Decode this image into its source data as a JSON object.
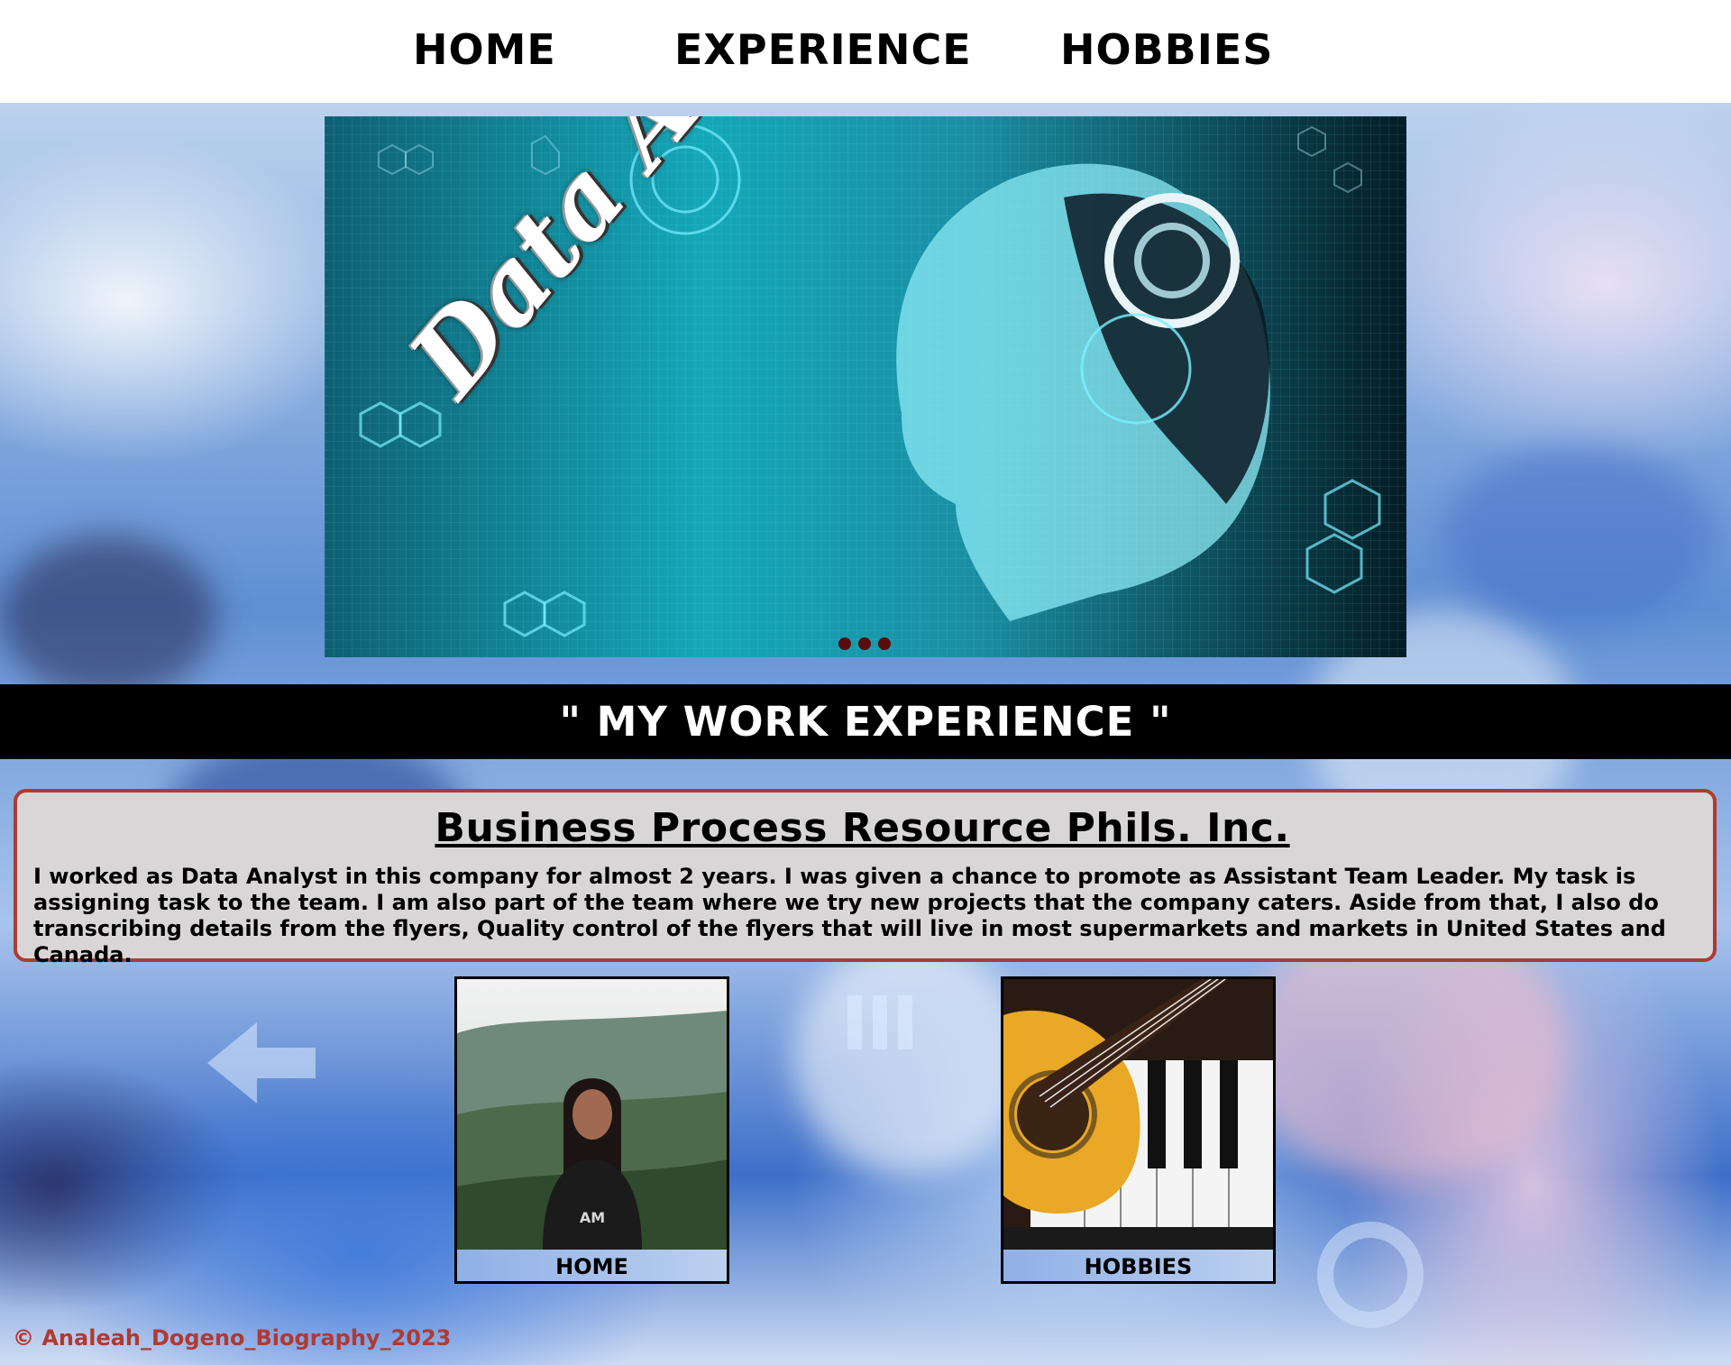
{
  "nav": {
    "home": "HOME",
    "experience": "EXPERIENCE",
    "hobbies": "HOBBIES"
  },
  "hero": {
    "title": "Data Analyst",
    "slide_count": 3
  },
  "section": {
    "heading": "\" MY WORK EXPERIENCE \""
  },
  "experience": {
    "company": "Business Process Resource Phils. Inc.",
    "description": "I worked as Data Analyst in this company for almost 2 years. I was given a chance to promote as Assistant Team Leader. My task is assigning task to the team. I am also part of the team where we try new projects that the company caters. Aside from that, I also do transcribing details from the flyers, Quality control of the flyers that will live in most supermarkets and markets in United States and Canada."
  },
  "thumbnails": [
    {
      "caption": "HOME",
      "image": "profile-photo"
    },
    {
      "caption": "HOBBIES",
      "image": "guitar-piano-photo"
    }
  ],
  "footer": {
    "copyright": "© Analeah_Dogeno_Biography_2023"
  },
  "colors": {
    "band": "#000000",
    "card_bg": "#d8d6d6",
    "card_border": "#b03a32",
    "copyright": "#b03a32",
    "dot": "#5a0d0d"
  }
}
